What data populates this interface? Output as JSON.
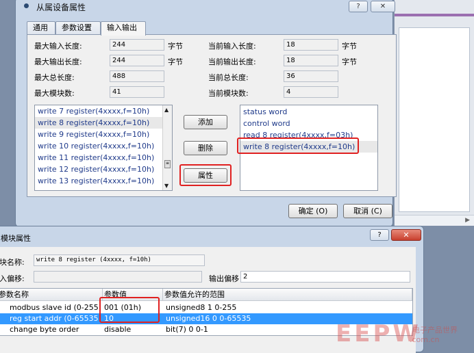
{
  "dialog1": {
    "title": "从属设备属性",
    "help_icon": "?",
    "close_icon": "✕",
    "tabs": [
      "通用",
      "参数设置",
      "输入输出"
    ],
    "active_tab": "输入输出",
    "fields": {
      "max_input_len": {
        "label": "最大输入长度:",
        "value": "244",
        "unit": "字节"
      },
      "max_output_len": {
        "label": "最大输出长度:",
        "value": "244",
        "unit": "字节"
      },
      "max_total_len": {
        "label": "最大总长度:",
        "value": "488"
      },
      "max_modules": {
        "label": "最大模块数:",
        "value": "41"
      },
      "cur_input_len": {
        "label": "当前输入长度:",
        "value": "18",
        "unit": "字节"
      },
      "cur_output_len": {
        "label": "当前输出长度:",
        "value": "18",
        "unit": "字节"
      },
      "cur_total_len": {
        "label": "当前总长度:",
        "value": "36"
      },
      "cur_modules": {
        "label": "当前模块数:",
        "value": "4"
      }
    },
    "available_modules": [
      "write 7 register(4xxxx,f=10h)",
      "write 8 register(4xxxx,f=10h)",
      "write 9 register(4xxxx,f=10h)",
      "write 10 register(4xxxx,f=10h)",
      "write 11 register(4xxxx,f=10h)",
      "write 12 register(4xxxx,f=10h)",
      "write 13 register(4xxxx,f=10h)"
    ],
    "configured_modules": [
      "status word",
      "control word",
      "read 8 register(4xxxx,f=03h)",
      "write 8 register(4xxxx,f=10h)"
    ],
    "buttons": {
      "add": "添加",
      "delete": "删除",
      "properties": "属性",
      "ok": "确定 (O)",
      "cancel": "取消 (C)"
    }
  },
  "dialog2": {
    "title": "模块属性",
    "help_icon": "?",
    "close_icon": "✕",
    "module_name_label": "块名称:",
    "module_name_value": "write 8 register (4xxxx, f=10h)",
    "input_offset_label": "入偏移:",
    "output_offset_label": "输出偏移",
    "output_offset_value": "2",
    "columns": [
      "参数名称",
      "参数值",
      "参数值允许的范围"
    ],
    "rows": [
      {
        "name": "modbus slave id (0-255",
        "value": "001 (01h)",
        "range": "unsigned8 1 0-255"
      },
      {
        "name": "reg start addr (0-65535",
        "value": "10",
        "range": "unsigned16 0 0-65535"
      },
      {
        "name": "change byte order",
        "value": "disable",
        "range": "bit(7) 0 0-1"
      }
    ]
  },
  "watermark": {
    "big": "EEPW",
    "small": "电子产品世界",
    "domain": ".com.cn"
  }
}
